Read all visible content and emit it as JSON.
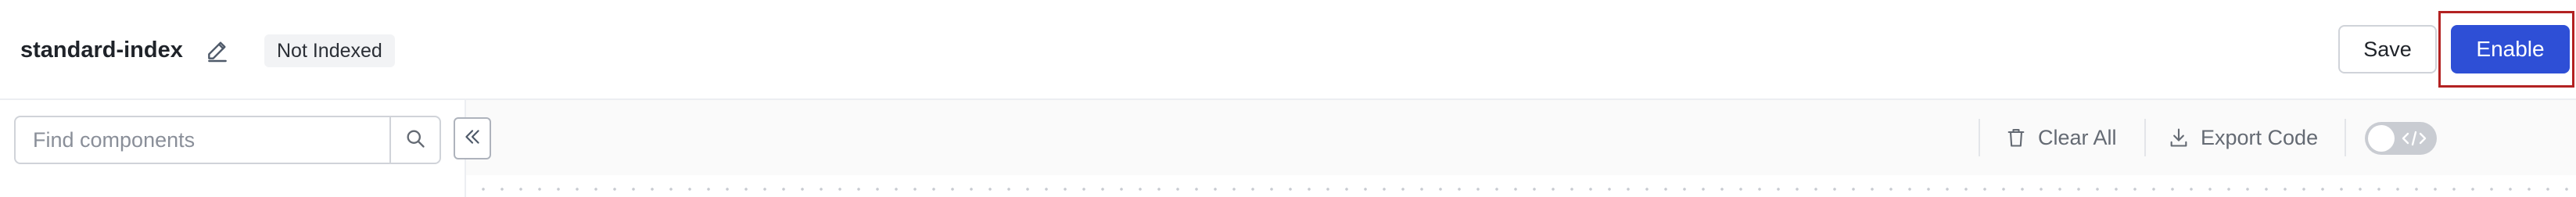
{
  "header": {
    "title": "standard-index",
    "status_badge": "Not Indexed",
    "save_label": "Save",
    "enable_label": "Enable",
    "edit_icon": "pencil-icon"
  },
  "sidebar": {
    "search_placeholder": "Find components",
    "search_icon": "search-icon",
    "collapse_icon": "double-chevron-left-icon"
  },
  "toolbar": {
    "clear_all_label": "Clear All",
    "clear_all_icon": "trash-icon",
    "export_code_label": "Export Code",
    "export_code_icon": "download-icon",
    "code_view_toggle_on": false,
    "code_view_toggle_icon": "code-icon"
  },
  "colors": {
    "primary": "#2e4fd6",
    "highlight_border": "#b32222",
    "toggle_off": "#c9ccd2"
  }
}
